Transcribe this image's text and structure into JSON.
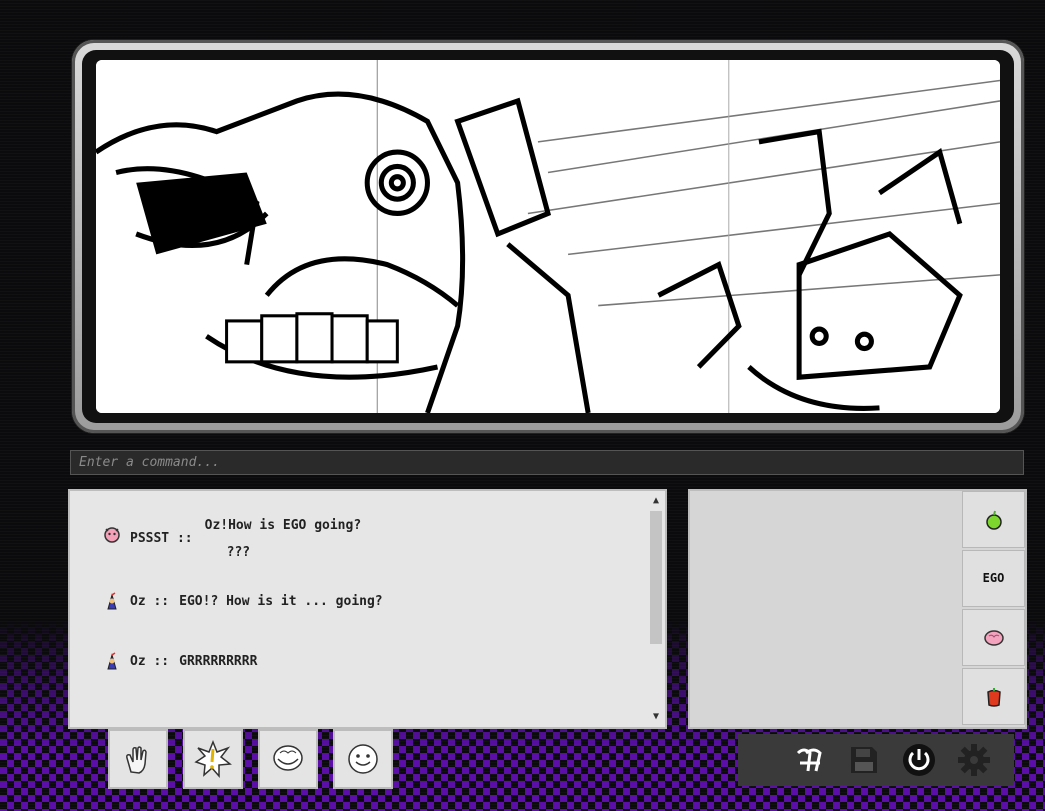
{
  "command": {
    "placeholder": "Enter a command..."
  },
  "log": {
    "messages": [
      {
        "speaker": "PSSST ::",
        "lines": [
          "Oz!How is EGO going?",
          "???"
        ],
        "icon": "pink-creature-icon"
      },
      {
        "speaker": "Oz ::",
        "text": "EGO!?  How is it ... going?",
        "icon": "oz-figure-icon"
      },
      {
        "speaker": "Oz ::",
        "text": "GRRRRRRRRR",
        "icon": "oz-figure-icon"
      }
    ]
  },
  "inventory": {
    "items": [
      {
        "name": "apple-icon",
        "label": ""
      },
      {
        "name": "ego-icon",
        "label": "EGO"
      },
      {
        "name": "brain-icon",
        "label": ""
      },
      {
        "name": "red-pepper-icon",
        "label": ""
      }
    ]
  },
  "actions": [
    {
      "name": "hand-icon"
    },
    {
      "name": "alert-icon"
    },
    {
      "name": "mouth-icon"
    },
    {
      "name": "face-icon"
    }
  ],
  "system": [
    "logo-icon",
    "save-icon",
    "power-icon",
    "settings-icon"
  ],
  "colors": {
    "purple": "#5b0fa8"
  }
}
